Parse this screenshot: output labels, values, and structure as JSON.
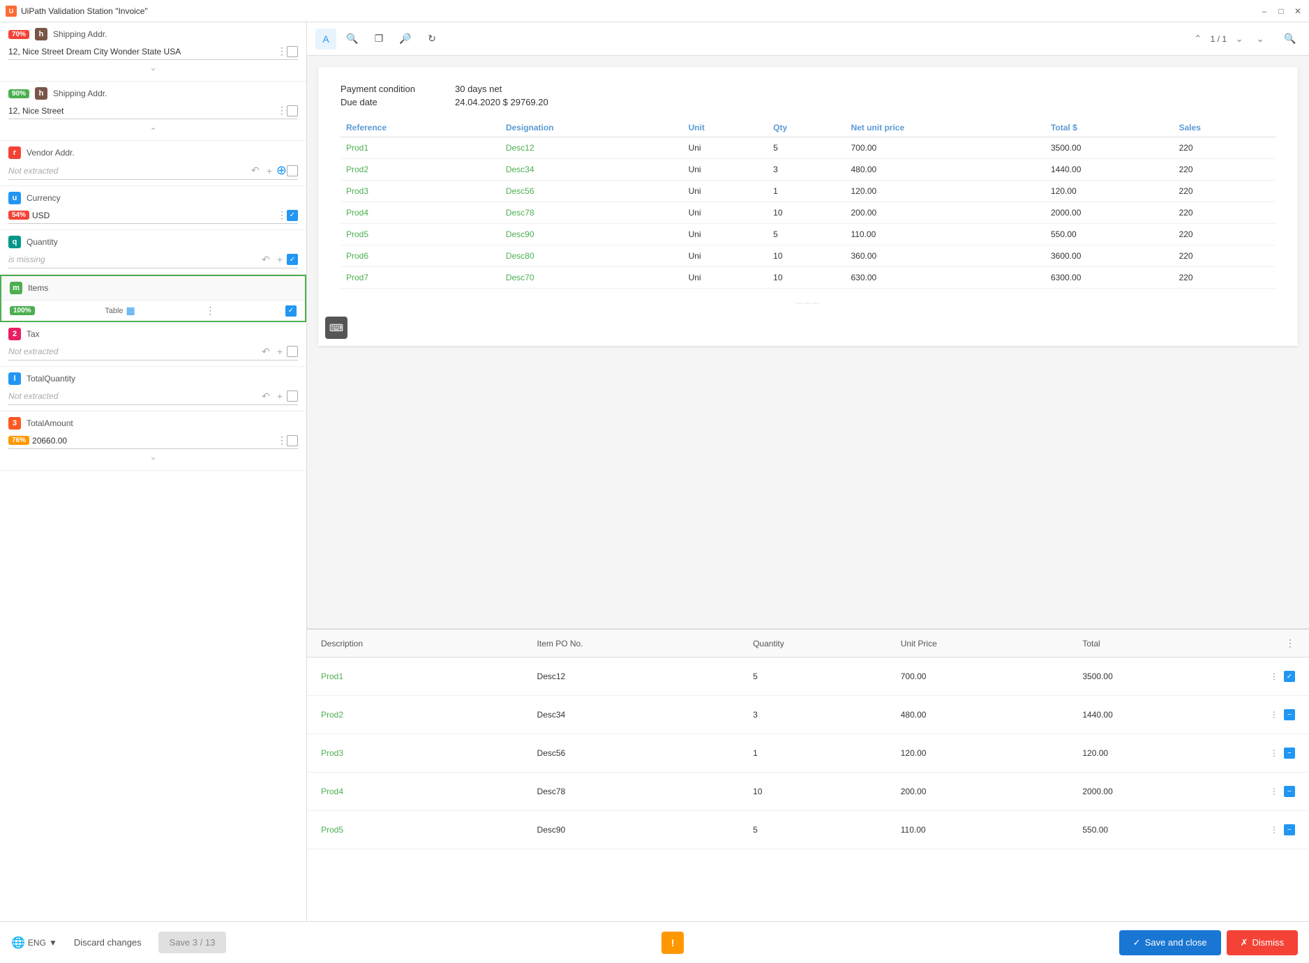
{
  "titleBar": {
    "icon": "U",
    "title": "UiPath Validation Station \"Invoice\"",
    "controls": [
      "minimize",
      "maximize",
      "close"
    ]
  },
  "leftPanel": {
    "fields": [
      {
        "id": "shipping-addr-value",
        "badge": "h",
        "badgeColor": "badge-brown",
        "name": "Shipping Addr.",
        "confidence": "70%",
        "confColor": "conf-red",
        "value": "12, Nice Street Dream City Wonder State USA",
        "hasMenu": true,
        "hasCheckbox": true,
        "checkboxChecked": false,
        "showChevron": true
      },
      {
        "id": "shipping-addr-short",
        "badge": "h",
        "badgeColor": "badge-brown",
        "name": "Shipping Addr.",
        "confidence": "90%",
        "confColor": "conf-green",
        "value": "12, Nice Street",
        "hasMenu": true,
        "hasCheckbox": true,
        "checkboxChecked": false,
        "showChevron": true
      },
      {
        "id": "vendor-addr",
        "badge": "r",
        "badgeColor": "badge-red",
        "name": "Vendor Addr.",
        "confidence": null,
        "value": null,
        "notExtracted": true,
        "hasUndo": true,
        "hasPlus": true,
        "hasPlusCircle": true,
        "hasCheckbox": true,
        "checkboxChecked": false
      },
      {
        "id": "currency",
        "badge": "u",
        "badgeColor": "badge-blue",
        "name": "Currency",
        "confidence": "54%",
        "confColor": "conf-red",
        "value": "USD",
        "hasMenu": true,
        "hasCheckbox": true,
        "checkboxChecked": true
      },
      {
        "id": "quantity",
        "badge": "q",
        "badgeColor": "badge-teal",
        "name": "Quantity",
        "confidence": null,
        "value": null,
        "isMissing": true,
        "hasUndo": true,
        "hasPlus": true,
        "hasCheckbox": true,
        "checkboxChecked": true
      },
      {
        "id": "items",
        "badge": "m",
        "badgeColor": "badge-green",
        "name": "Items",
        "confidence": "100%",
        "confColor": "conf-green",
        "isTable": true,
        "tableLabel": "Table",
        "hasMenu": true,
        "hasCheckbox": true,
        "checkboxChecked": true,
        "isItemsSection": true
      },
      {
        "id": "tax",
        "badge": "2",
        "badgeColor": "badge-num-2",
        "name": "Tax",
        "confidence": null,
        "value": null,
        "notExtracted": true,
        "hasUndo": true,
        "hasPlus": true,
        "hasCheckbox": true,
        "checkboxChecked": false
      },
      {
        "id": "total-quantity",
        "badge": "l",
        "badgeColor": "badge-blue",
        "name": "TotalQuantity",
        "confidence": null,
        "value": null,
        "notExtracted": true,
        "hasUndo": true,
        "hasPlus": true,
        "hasCheckbox": true,
        "checkboxChecked": false
      },
      {
        "id": "total-amount",
        "badge": "3",
        "badgeColor": "badge-num-3",
        "name": "TotalAmount",
        "confidence": "76%",
        "confColor": "conf-orange",
        "value": "20660.00",
        "hasMenu": true,
        "hasCheckbox": true,
        "checkboxChecked": false,
        "showChevron": true
      }
    ]
  },
  "docToolbar": {
    "textBtn": "A",
    "zoomInLabel": "+",
    "expandLabel": "⤢",
    "zoomOutLabel": "−",
    "refreshLabel": "↺",
    "pageInfo": "1 / 1",
    "searchLabel": "🔍"
  },
  "document": {
    "paymentCondition": {
      "label": "Payment condition",
      "value": "30 days net"
    },
    "dueDate": {
      "label": "Due date",
      "value": "24.04.2020 $ 29769.20"
    },
    "tableHeaders": [
      "Reference",
      "Designation",
      "Unit",
      "Qty",
      "Net unit price",
      "Total $",
      "Sales"
    ],
    "tableRows": [
      {
        "ref": "Prod1",
        "desc": "Desc12",
        "unit": "Uni",
        "qty": "5",
        "price": "700.00",
        "total": "3500.00",
        "sales": "220"
      },
      {
        "ref": "Prod2",
        "desc": "Desc34",
        "unit": "Uni",
        "qty": "3",
        "price": "480.00",
        "total": "1440.00",
        "sales": "220"
      },
      {
        "ref": "Prod3",
        "desc": "Desc56",
        "unit": "Uni",
        "qty": "1",
        "price": "120.00",
        "total": "120.00",
        "sales": "220"
      },
      {
        "ref": "Prod4",
        "desc": "Desc78",
        "unit": "Uni",
        "qty": "10",
        "price": "200.00",
        "total": "2000.00",
        "sales": "220"
      },
      {
        "ref": "Prod5",
        "desc": "Desc90",
        "unit": "Uni",
        "qty": "5",
        "price": "110.00",
        "total": "550.00",
        "sales": "220"
      },
      {
        "ref": "Prod6",
        "desc": "Desc80",
        "unit": "Uni",
        "qty": "10",
        "price": "360.00",
        "total": "3600.00",
        "sales": "220"
      },
      {
        "ref": "Prod7",
        "desc": "Desc70",
        "unit": "Uni",
        "qty": "10",
        "price": "630.00",
        "total": "6300.00",
        "sales": "220"
      }
    ]
  },
  "bottomTable": {
    "headers": [
      "Description",
      "Item PO No.",
      "Quantity",
      "Unit Price",
      "Total"
    ],
    "rows": [
      {
        "desc": "Prod1",
        "item": "Desc12",
        "qty": "5",
        "price": "700.00",
        "total": "3500.00",
        "checkType": "blue-check"
      },
      {
        "desc": "Prod2",
        "item": "Desc34",
        "qty": "3",
        "price": "480.00",
        "total": "1440.00",
        "checkType": "blue-minus"
      },
      {
        "desc": "Prod3",
        "item": "Desc56",
        "qty": "1",
        "price": "120.00",
        "total": "120.00",
        "checkType": "blue-minus"
      },
      {
        "desc": "Prod4",
        "item": "Desc78",
        "qty": "10",
        "price": "200.00",
        "total": "2000.00",
        "checkType": "blue-minus"
      },
      {
        "desc": "Prod5",
        "item": "Desc90",
        "qty": "5",
        "price": "110.00",
        "total": "550.00",
        "checkType": "blue-minus"
      }
    ]
  },
  "bottomBar": {
    "language": "ENG",
    "discardLabel": "Discard changes",
    "saveProgressLabel": "Save 3 / 13",
    "alertLabel": "!",
    "saveCloseLabel": "Save and close",
    "dismissLabel": "Dismiss"
  }
}
